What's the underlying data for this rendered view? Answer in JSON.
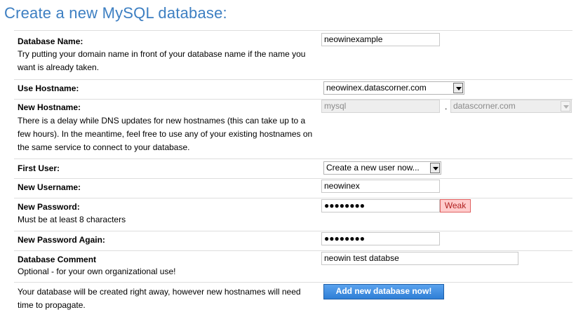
{
  "page": {
    "title": "Create a new MySQL database:"
  },
  "fields": {
    "database_name": {
      "label": "Database Name:",
      "help": "Try putting your domain name in front of your database name if the name you want is already taken.",
      "value": "neowinexample"
    },
    "use_hostname": {
      "label": "Use Hostname:",
      "value": "neowinex.datascorner.com"
    },
    "new_hostname": {
      "label": "New Hostname:",
      "help": "There is a delay while DNS updates for new hostnames (this can take up to a few hours). In the meantime, feel free to use any of your existing hostnames on the same service to connect to your database.",
      "subdomain": "mysql",
      "separator": ".",
      "domain": "datascorner.com"
    },
    "first_user": {
      "label": "First User:",
      "value": "Create a new user now..."
    },
    "new_username": {
      "label": "New Username:",
      "value": "neowinex"
    },
    "new_password": {
      "label": "New Password:",
      "help": "Must be at least 8 characters",
      "masked": "●●●●●●●●",
      "strength": "Weak"
    },
    "new_password_again": {
      "label": "New Password Again:",
      "masked": "●●●●●●●●"
    },
    "database_comment": {
      "label": "Database Comment",
      "help": "Optional - for your own organizational use!",
      "value": "neowin test databse"
    }
  },
  "footer": {
    "note": "Your database will be created right away, however new hostnames will need time to propagate.",
    "submit_label": "Add new database now!"
  }
}
